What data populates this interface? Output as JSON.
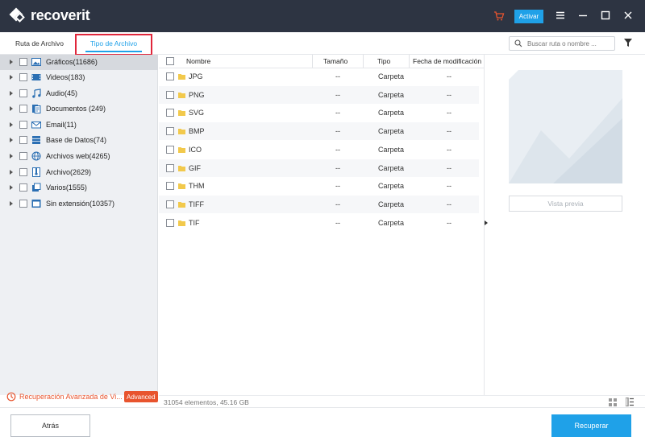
{
  "app": {
    "logo_text": "recoverit"
  },
  "header": {
    "activate_label": "Activar"
  },
  "tabs": [
    {
      "label": "Ruta de Archivo",
      "active": false
    },
    {
      "label": "Tipo de Archivo",
      "active": true
    }
  ],
  "search": {
    "placeholder": "Buscar ruta o nombre ..."
  },
  "sidebar": {
    "items": [
      {
        "label": "Gráficos(11686)",
        "icon": "image-icon",
        "selected": true
      },
      {
        "label": "Videos(183)",
        "icon": "video-icon"
      },
      {
        "label": "Audio(45)",
        "icon": "music-icon"
      },
      {
        "label": "Documentos  (249)",
        "icon": "document-icon"
      },
      {
        "label": "Email(11)",
        "icon": "email-icon"
      },
      {
        "label": "Base de Datos(74)",
        "icon": "database-icon"
      },
      {
        "label": "Archivos web(4265)",
        "icon": "globe-icon"
      },
      {
        "label": "Archivo(2629)",
        "icon": "archive-icon"
      },
      {
        "label": "Varios(1555)",
        "icon": "misc-icon"
      },
      {
        "label": "Sin extensión(10357)",
        "icon": "no-extension-icon"
      }
    ],
    "advanced_text": "Recuperación Avanzada de Vi...",
    "advanced_badge": "Advanced"
  },
  "table": {
    "headers": {
      "name": "Nombre",
      "size": "Tamaño",
      "type": "Tipo",
      "modified": "Fecha de modificación"
    },
    "rows": [
      {
        "name": "JPG",
        "size": "--",
        "type": "Carpeta",
        "modified": "--"
      },
      {
        "name": "PNG",
        "size": "--",
        "type": "Carpeta",
        "modified": "--"
      },
      {
        "name": "SVG",
        "size": "--",
        "type": "Carpeta",
        "modified": "--"
      },
      {
        "name": "BMP",
        "size": "--",
        "type": "Carpeta",
        "modified": "--"
      },
      {
        "name": "ICO",
        "size": "--",
        "type": "Carpeta",
        "modified": "--"
      },
      {
        "name": "GIF",
        "size": "--",
        "type": "Carpeta",
        "modified": "--"
      },
      {
        "name": "THM",
        "size": "--",
        "type": "Carpeta",
        "modified": "--"
      },
      {
        "name": "TIFF",
        "size": "--",
        "type": "Carpeta",
        "modified": "--"
      },
      {
        "name": "TIF",
        "size": "--",
        "type": "Carpeta",
        "modified": "--"
      }
    ]
  },
  "preview": {
    "button_label": "Vista previa"
  },
  "status": {
    "summary": "31054 elementos, 45.16  GB"
  },
  "footer": {
    "back_label": "Atrás",
    "recover_label": "Recuperar"
  },
  "colors": {
    "accent": "#1fa1e8",
    "titlebar": "#2d3442",
    "highlight": "#e0263b",
    "advanced": "#e8542e",
    "cart": "#e8542e"
  }
}
